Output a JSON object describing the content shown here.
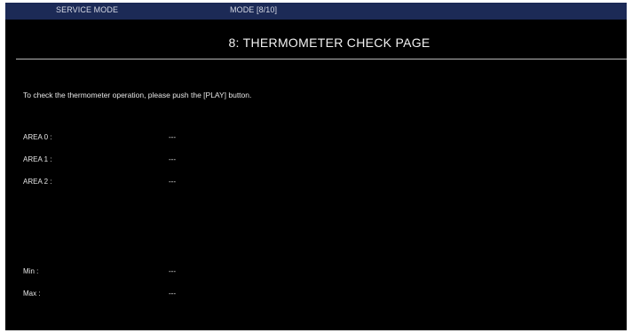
{
  "header": {
    "service_mode": "SERVICE MODE",
    "mode_indicator": "MODE [8/10]"
  },
  "page": {
    "title": "8: THERMOMETER CHECK PAGE",
    "instruction": "To check the thermometer operation, please push the [PLAY] button."
  },
  "readings": {
    "area0": {
      "label": "AREA 0 :",
      "value": "---"
    },
    "area1": {
      "label": "AREA 1 :",
      "value": "---"
    },
    "area2": {
      "label": "AREA 2 :",
      "value": "---"
    },
    "min": {
      "label": "Min :",
      "value": "---"
    },
    "max": {
      "label": "Max :",
      "value": "---"
    }
  },
  "colors": {
    "background": "#000000",
    "header_bar": "#1c2a56",
    "text": "#e6e6e6"
  }
}
